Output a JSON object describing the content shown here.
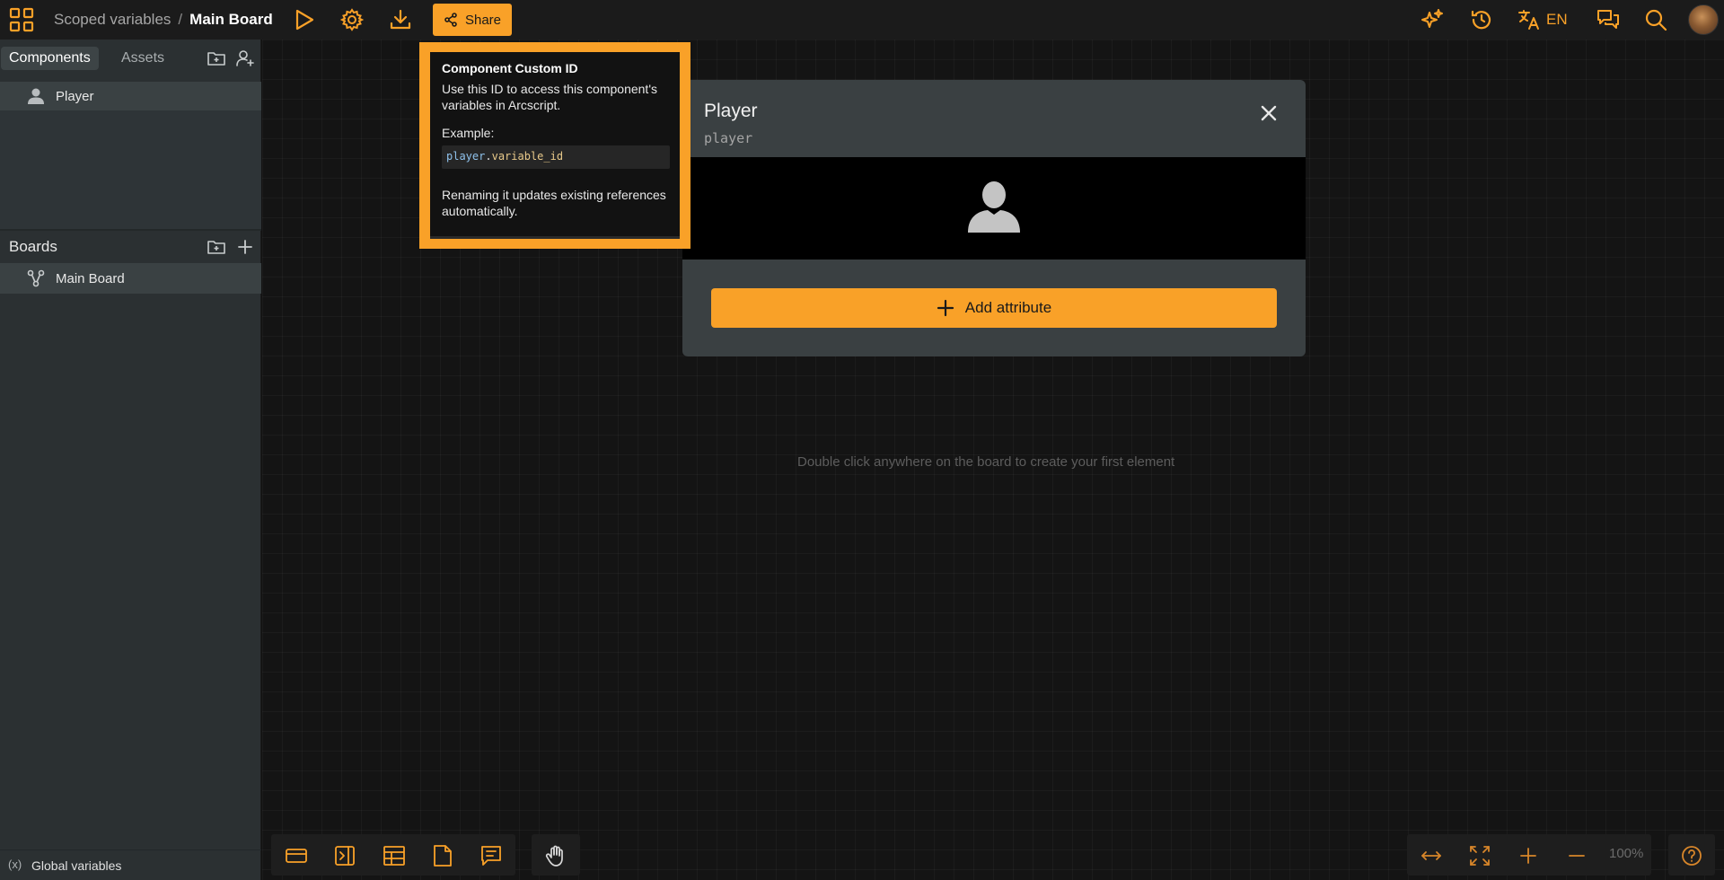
{
  "header": {
    "project_name": "Scoped variables",
    "separator": "/",
    "board_name": "Main Board",
    "share_label": "Share",
    "language": "EN"
  },
  "sidebar": {
    "tabs": [
      {
        "label": "Components",
        "active": true
      },
      {
        "label": "Assets",
        "active": false
      }
    ],
    "components": [
      {
        "label": "Player",
        "icon": "user-icon"
      }
    ],
    "boards_title": "Boards",
    "boards": [
      {
        "label": "Main Board",
        "icon": "board-tree-icon"
      }
    ],
    "global_variables_icon": "(x)",
    "global_variables_label": "Global variables"
  },
  "board": {
    "empty_hint": "Double click anywhere on the board to create your first element",
    "zoom": "100%"
  },
  "component_card": {
    "title": "Player",
    "custom_id": "player",
    "add_attribute_label": "Add attribute"
  },
  "tooltip": {
    "title": "Component Custom ID",
    "description": "Use this ID to access this component's variables in Arcscript.",
    "example_label": "Example:",
    "code_object": "player",
    "code_dot": ".",
    "code_var": "variable_id",
    "note": "Renaming it updates existing references automatically."
  },
  "colors": {
    "accent": "#f9a128",
    "background": "#121212",
    "sidebar": "#2b3032",
    "card": "#3a4042"
  }
}
